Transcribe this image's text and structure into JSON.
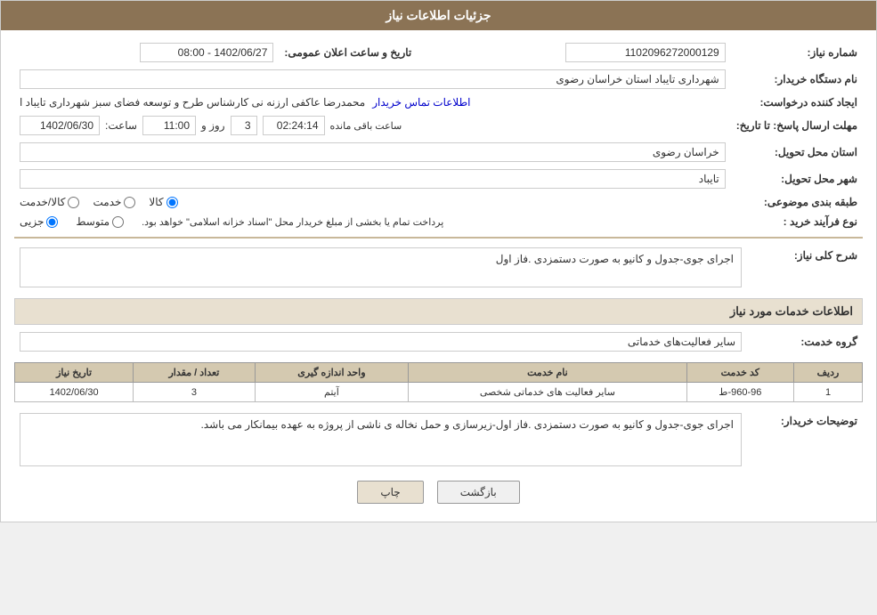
{
  "header": {
    "title": "جزئیات اطلاعات نیاز"
  },
  "fields": {
    "need_number_label": "شماره نیاز:",
    "need_number_value": "1102096272000129",
    "buyer_org_label": "نام دستگاه خریدار:",
    "buyer_org_value": "شهرداری تایباد استان خراسان رضوی",
    "date_time_label": "تاریخ و ساعت اعلان عمومی:",
    "date_time_value": "1402/06/27 - 08:00",
    "creator_label": "ایجاد کننده درخواست:",
    "creator_value": "محمدرضا عاکفی ارزنه نی کارشناس طرح و توسعه فضای سبز شهرداری تایباد ا",
    "contact_link": "اطلاعات تماس خریدار",
    "response_deadline_label": "مهلت ارسال پاسخ: تا تاریخ:",
    "response_date": "1402/06/30",
    "response_time_label": "ساعت:",
    "response_time": "11:00",
    "response_days_label": "روز و",
    "response_days": "3",
    "response_remaining_label": "ساعت باقی مانده",
    "response_remaining": "02:24:14",
    "delivery_province_label": "استان محل تحویل:",
    "delivery_province_value": "خراسان رضوی",
    "delivery_city_label": "شهر محل تحویل:",
    "delivery_city_value": "تایباد",
    "category_label": "طبقه بندی موضوعی:",
    "category_options": [
      "کالا",
      "خدمت",
      "کالا/خدمت"
    ],
    "category_selected": "کالا",
    "purchase_type_label": "نوع فرآیند خرید :",
    "purchase_type_options": [
      "جزیی",
      "متوسط"
    ],
    "purchase_note": "پرداخت تمام یا بخشی از مبلغ خریدار محل \"اسناد خزانه اسلامی\" خواهد بود.",
    "general_desc_label": "شرح کلی نیاز:",
    "general_desc_value": "اجرای جوی-جدول و کانیو به صورت دستمزدی .فاز اول",
    "services_info_label": "اطلاعات خدمات مورد نیاز",
    "service_group_label": "گروه خدمت:",
    "service_group_value": "سایر فعالیت‌های خدماتی",
    "table": {
      "headers": [
        "ردیف",
        "کد خدمت",
        "نام خدمت",
        "واحد اندازه گیری",
        "تعداد / مقدار",
        "تاریخ نیاز"
      ],
      "rows": [
        {
          "row": "1",
          "code": "960-96-ط",
          "name": "سایر فعالیت های خدماتی شخصی",
          "unit": "آیتم",
          "qty": "3",
          "date": "1402/06/30"
        }
      ]
    },
    "buyer_desc_label": "توضیحات خریدار:",
    "buyer_desc_value": "اجرای جوی-جدول و کانیو به صورت دستمزدی .فاز اول-زیرسازی و حمل نخاله ی ناشی از پروژه به عهده بیمانکار می باشد."
  },
  "buttons": {
    "print": "چاپ",
    "back": "بازگشت"
  }
}
